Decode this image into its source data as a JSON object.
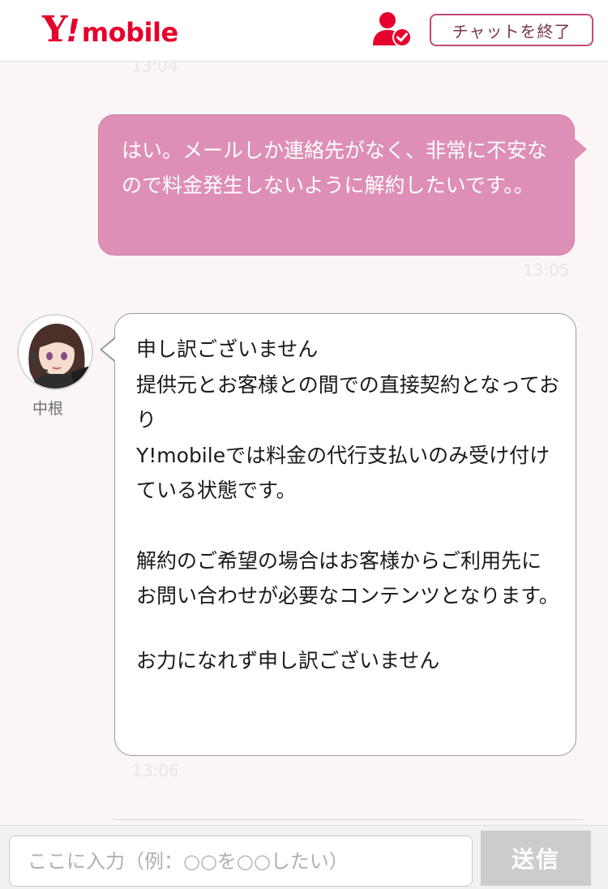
{
  "header": {
    "logo_y": "Y",
    "logo_ex": "!",
    "logo_mobile": "mobile",
    "end_chat_label": "チャットを終了",
    "operator_icon": "operator-check-icon"
  },
  "messages": {
    "top_cut_timestamp": "13:04",
    "user_message": "はい。メールしか連絡先がなく、非常に不安なので料金発生しないように解約したいです。。",
    "user_timestamp": "13:05",
    "agent_name": "中根",
    "agent_paragraphs": [
      "申し訳ございません\n提供元とお客様との間での直接契約となっており\nY!mobileでは料金の代行支払いのみ受け付けている状態です。",
      "解約のご希望の場合はお客様からご利用先にお問い合わせが必要なコンテンツとなります。",
      "お力になれず申し訳ございません"
    ],
    "agent_timestamp": "13:06"
  },
  "input": {
    "placeholder": "ここに入力（例：○○を○○したい）",
    "send_label": "送信"
  },
  "colors": {
    "brand_red": "#e5002d",
    "user_bubble": "#de8fb6",
    "end_chat_border": "#c24a77"
  }
}
